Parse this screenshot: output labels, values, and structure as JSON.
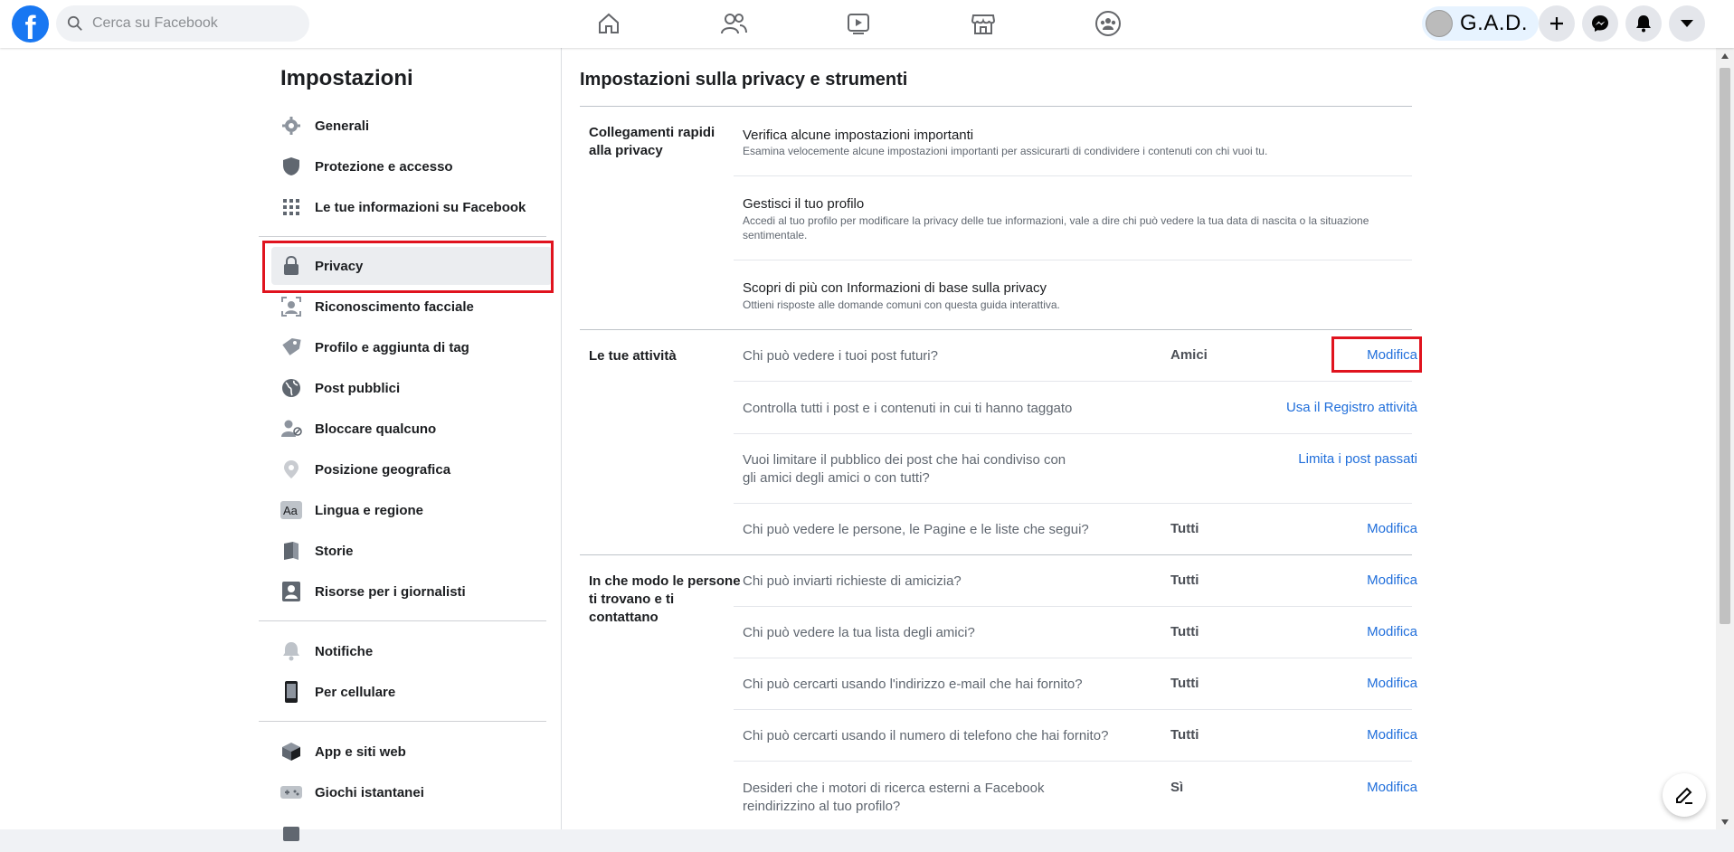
{
  "search": {
    "placeholder": "Cerca su Facebook"
  },
  "topnav": {
    "icons": [
      "home-icon",
      "friends-icon",
      "watch-icon",
      "marketplace-icon",
      "groups-icon"
    ],
    "user_name": "G.A.D.",
    "right_buttons": [
      "create-icon",
      "messenger-icon",
      "notifications-icon",
      "account-menu-icon"
    ]
  },
  "sidebar": {
    "title": "Impostazioni",
    "groups": [
      [
        {
          "label": "Generali",
          "icon": "gear-icon"
        },
        {
          "label": "Protezione e accesso",
          "icon": "shield-icon"
        },
        {
          "label": "Le tue informazioni su Facebook",
          "icon": "grid-icon"
        }
      ],
      [
        {
          "label": "Privacy",
          "icon": "lock-icon"
        },
        {
          "label": "Riconoscimento facciale",
          "icon": "face-recognition-icon"
        },
        {
          "label": "Profilo e aggiunta di tag",
          "icon": "tag-icon"
        },
        {
          "label": "Post pubblici",
          "icon": "globe-icon"
        },
        {
          "label": "Bloccare qualcuno",
          "icon": "block-user-icon"
        },
        {
          "label": "Posizione geografica",
          "icon": "location-pin-icon"
        },
        {
          "label": "Lingua e regione",
          "icon": "language-icon"
        },
        {
          "label": "Storie",
          "icon": "book-icon"
        },
        {
          "label": "Risorse per i giornalisti",
          "icon": "journalist-icon"
        }
      ],
      [
        {
          "label": "Notifiche",
          "icon": "bell-icon"
        },
        {
          "label": "Per cellulare",
          "icon": "mobile-icon"
        }
      ],
      [
        {
          "label": "App e siti web",
          "icon": "cube-icon"
        },
        {
          "label": "Giochi istantanei",
          "icon": "gamepad-icon"
        }
      ]
    ],
    "active": "Privacy"
  },
  "main": {
    "title": "Impostazioni sulla privacy e strumenti",
    "quick_links": {
      "label": "Collegamenti rapidi alla privacy",
      "items": [
        {
          "title": "Verifica alcune impostazioni importanti",
          "desc": "Esamina velocemente alcune impostazioni importanti per assicurarti di condividere i contenuti con chi vuoi tu."
        },
        {
          "title": "Gestisci il tuo profilo",
          "desc": "Accedi al tuo profilo per modificare la privacy delle tue informazioni, vale a dire chi può vedere la tua data di nascita o la situazione sentimentale."
        },
        {
          "title": "Scopri di più con Informazioni di base sulla privacy",
          "desc": "Ottieni risposte alle domande comuni con questa guida interattiva."
        }
      ]
    },
    "activity": {
      "label": "Le tue attività",
      "rows": [
        {
          "question": "Chi può vedere i tuoi post futuri?",
          "value": "Amici",
          "action": "Modifica"
        },
        {
          "question": "Controlla tutti i post e i contenuti in cui ti hanno taggato",
          "value": "",
          "action": "Usa il Registro attività"
        },
        {
          "question": "Vuoi limitare il pubblico dei post che hai condiviso con gli amici degli amici o con tutti?",
          "value": "",
          "action": "Limita i post passati"
        },
        {
          "question": "Chi può vedere le persone, le Pagine e le liste che segui?",
          "value": "Tutti",
          "action": "Modifica"
        }
      ]
    },
    "contact": {
      "label": "In che modo le persone ti trovano e ti contattano",
      "rows": [
        {
          "question": "Chi può inviarti richieste di amicizia?",
          "value": "Tutti",
          "action": "Modifica"
        },
        {
          "question": "Chi può vedere la tua lista degli amici?",
          "value": "Tutti",
          "action": "Modifica"
        },
        {
          "question": "Chi può cercarti usando l'indirizzo e-mail che hai fornito?",
          "value": "Tutti",
          "action": "Modifica"
        },
        {
          "question": "Chi può cercarti usando il numero di telefono che hai fornito?",
          "value": "Tutti",
          "action": "Modifica"
        },
        {
          "question": "Desideri che i motori di ricerca esterni a Facebook reindirizzino al tuo profilo?",
          "value": "Sì",
          "action": "Modifica"
        }
      ]
    }
  },
  "colors": {
    "brand": "#1877f2",
    "link": "#216fdb",
    "highlight": "#e0131e"
  }
}
